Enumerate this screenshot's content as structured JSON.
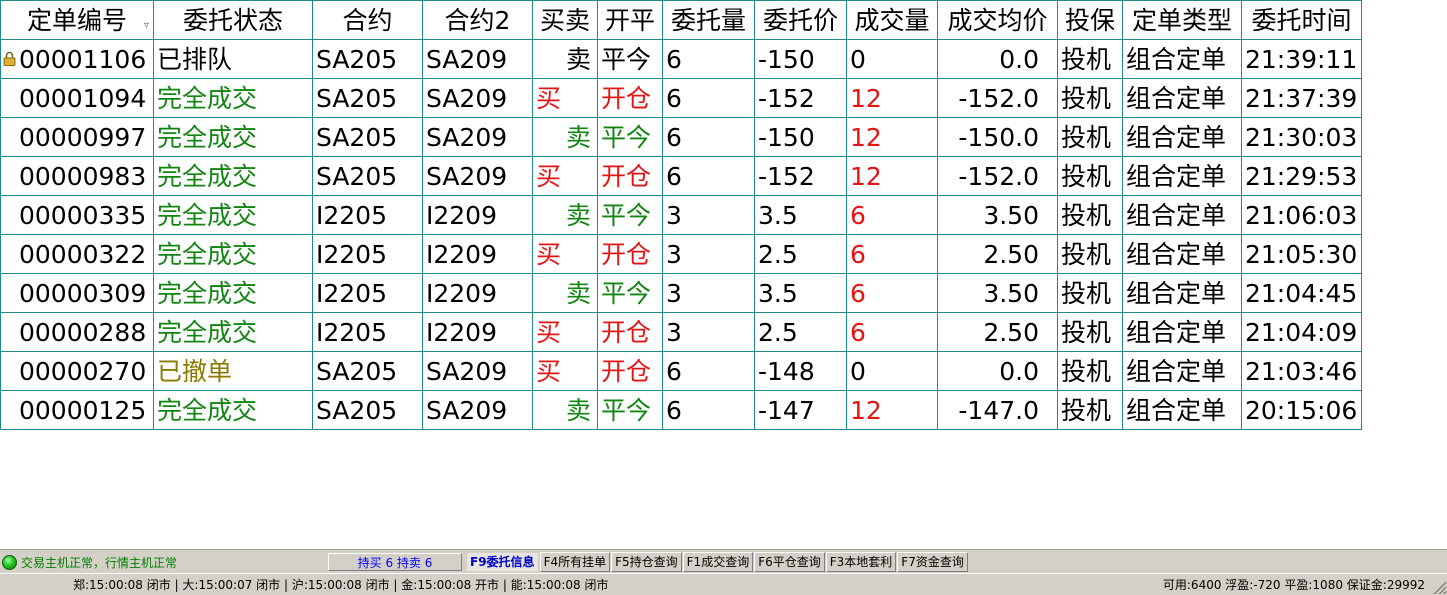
{
  "table": {
    "columns": [
      "定单编号",
      "委托状态",
      "合约",
      "合约2",
      "买卖",
      "开平",
      "委托量",
      "委托价",
      "成交量",
      "成交均价",
      "投保",
      "定单类型",
      "委托时间"
    ],
    "rows": [
      {
        "id": "00001106",
        "status": "已排队",
        "status_type": "queued",
        "contract": "SA205",
        "contract2": "SA209",
        "side": "卖",
        "side_type": "sell",
        "openclose": "平今",
        "qty": "6",
        "price": "-150",
        "filled": "0",
        "avg": "0.0",
        "hedge": "投机",
        "order_type": "组合定单",
        "time": "21:39:11",
        "locked": true
      },
      {
        "id": "00001094",
        "status": "完全成交",
        "status_type": "done",
        "contract": "SA205",
        "contract2": "SA209",
        "side": "买",
        "side_type": "buy",
        "openclose": "开仓",
        "qty": "6",
        "price": "-152",
        "filled": "12",
        "avg": "-152.0",
        "hedge": "投机",
        "order_type": "组合定单",
        "time": "21:37:39",
        "locked": false
      },
      {
        "id": "00000997",
        "status": "完全成交",
        "status_type": "done",
        "contract": "SA205",
        "contract2": "SA209",
        "side": "卖",
        "side_type": "sell",
        "openclose": "平今",
        "qty": "6",
        "price": "-150",
        "filled": "12",
        "avg": "-150.0",
        "hedge": "投机",
        "order_type": "组合定单",
        "time": "21:30:03",
        "locked": false
      },
      {
        "id": "00000983",
        "status": "完全成交",
        "status_type": "done",
        "contract": "SA205",
        "contract2": "SA209",
        "side": "买",
        "side_type": "buy",
        "openclose": "开仓",
        "qty": "6",
        "price": "-152",
        "filled": "12",
        "avg": "-152.0",
        "hedge": "投机",
        "order_type": "组合定单",
        "time": "21:29:53",
        "locked": false
      },
      {
        "id": "00000335",
        "status": "完全成交",
        "status_type": "done",
        "contract": "I2205",
        "contract2": "I2209",
        "side": "卖",
        "side_type": "sell",
        "openclose": "平今",
        "qty": "3",
        "price": "3.5",
        "filled": "6",
        "avg": "3.50",
        "hedge": "投机",
        "order_type": "组合定单",
        "time": "21:06:03",
        "locked": false
      },
      {
        "id": "00000322",
        "status": "完全成交",
        "status_type": "done",
        "contract": "I2205",
        "contract2": "I2209",
        "side": "买",
        "side_type": "buy",
        "openclose": "开仓",
        "qty": "3",
        "price": "2.5",
        "filled": "6",
        "avg": "2.50",
        "hedge": "投机",
        "order_type": "组合定单",
        "time": "21:05:30",
        "locked": false
      },
      {
        "id": "00000309",
        "status": "完全成交",
        "status_type": "done",
        "contract": "I2205",
        "contract2": "I2209",
        "side": "卖",
        "side_type": "sell",
        "openclose": "平今",
        "qty": "3",
        "price": "3.5",
        "filled": "6",
        "avg": "3.50",
        "hedge": "投机",
        "order_type": "组合定单",
        "time": "21:04:45",
        "locked": false
      },
      {
        "id": "00000288",
        "status": "完全成交",
        "status_type": "done",
        "contract": "I2205",
        "contract2": "I2209",
        "side": "买",
        "side_type": "buy",
        "openclose": "开仓",
        "qty": "3",
        "price": "2.5",
        "filled": "6",
        "avg": "2.50",
        "hedge": "投机",
        "order_type": "组合定单",
        "time": "21:04:09",
        "locked": false
      },
      {
        "id": "00000270",
        "status": "已撤单",
        "status_type": "cancel",
        "contract": "SA205",
        "contract2": "SA209",
        "side": "买",
        "side_type": "buy",
        "openclose": "开仓",
        "qty": "6",
        "price": "-148",
        "filled": "0",
        "avg": "0.0",
        "hedge": "投机",
        "order_type": "组合定单",
        "time": "21:03:46",
        "locked": false
      },
      {
        "id": "00000125",
        "status": "完全成交",
        "status_type": "done",
        "contract": "SA205",
        "contract2": "SA209",
        "side": "卖",
        "side_type": "sell",
        "openclose": "平今",
        "qty": "6",
        "price": "-147",
        "filled": "12",
        "avg": "-147.0",
        "hedge": "投机",
        "order_type": "组合定单",
        "time": "20:15:06",
        "locked": false
      }
    ]
  },
  "statusbar": {
    "connection": "交易主机正常，行情主机正常",
    "position_summary": "持买 6  持卖 6",
    "tabs": [
      {
        "label": "F9委托信息",
        "active": true
      },
      {
        "label": "F4所有挂单",
        "active": false
      },
      {
        "label": "F5持仓查询",
        "active": false
      },
      {
        "label": "F1成交查询",
        "active": false
      },
      {
        "label": "F6平仓查询",
        "active": false
      },
      {
        "label": "F3本地套利",
        "active": false
      },
      {
        "label": "F7资金查询",
        "active": false
      }
    ],
    "exchanges": "郑:15:00:08 闭市 | 大:15:00:07 闭市 | 沪:15:00:08 闭市 | 金:15:00:08 开市 | 能:15:00:08 闭市",
    "funds": "可用:6400 浮盈:-720 平盈:1080 保证金:29992"
  },
  "colors": {
    "grid_line": "#1f8a8a",
    "buy_red": "#e51414",
    "sell_green": "#128512",
    "cancel_olive": "#8a7a00",
    "active_tab_blue": "#0000c8"
  },
  "icons": {
    "lock": "lock-icon",
    "sort": "sort-icon",
    "connection": "status-led-icon"
  }
}
